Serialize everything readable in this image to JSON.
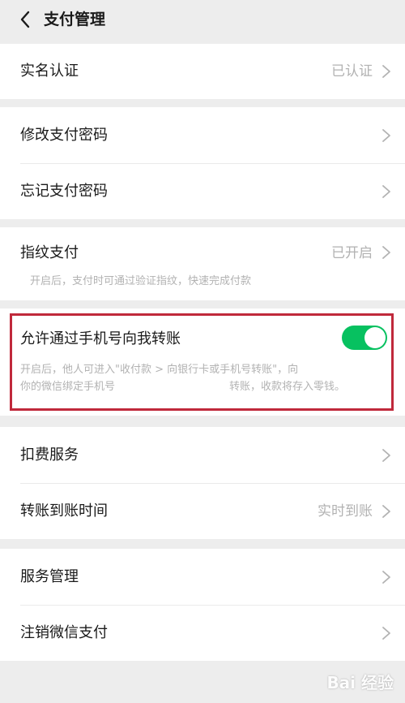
{
  "header": {
    "title": "支付管理"
  },
  "groups": {
    "realname": {
      "label": "实名认证",
      "value": "已认证"
    },
    "password": {
      "change_label": "修改支付密码",
      "forgot_label": "忘记支付密码"
    },
    "fingerprint": {
      "label": "指纹支付",
      "value": "已开启",
      "desc": "开启后，支付时可通过验证指纹，快速完成付款"
    },
    "phone_transfer": {
      "label": "允许通过手机号向我转账",
      "toggle_on": true,
      "desc_line1": "开启后，他人可进入\"收付款 > 向银行卡或手机号转账\"，向",
      "desc_line2_a": "你的微信绑定手机号",
      "desc_line2_b": "转账，收款将存入零钱。"
    },
    "services": {
      "deduction_label": "扣费服务",
      "arrival_label": "转账到账时间",
      "arrival_value": "实时到账"
    },
    "manage": {
      "service_manage_label": "服务管理",
      "cancel_label": "注销微信支付"
    }
  },
  "watermark": "Bai 经验",
  "colors": {
    "accent_green": "#07c160",
    "highlight_red": "#c0293b",
    "background": "#ededed"
  },
  "icons": {
    "back": "chevron-left-icon",
    "row_arrow": "chevron-right-icon"
  }
}
